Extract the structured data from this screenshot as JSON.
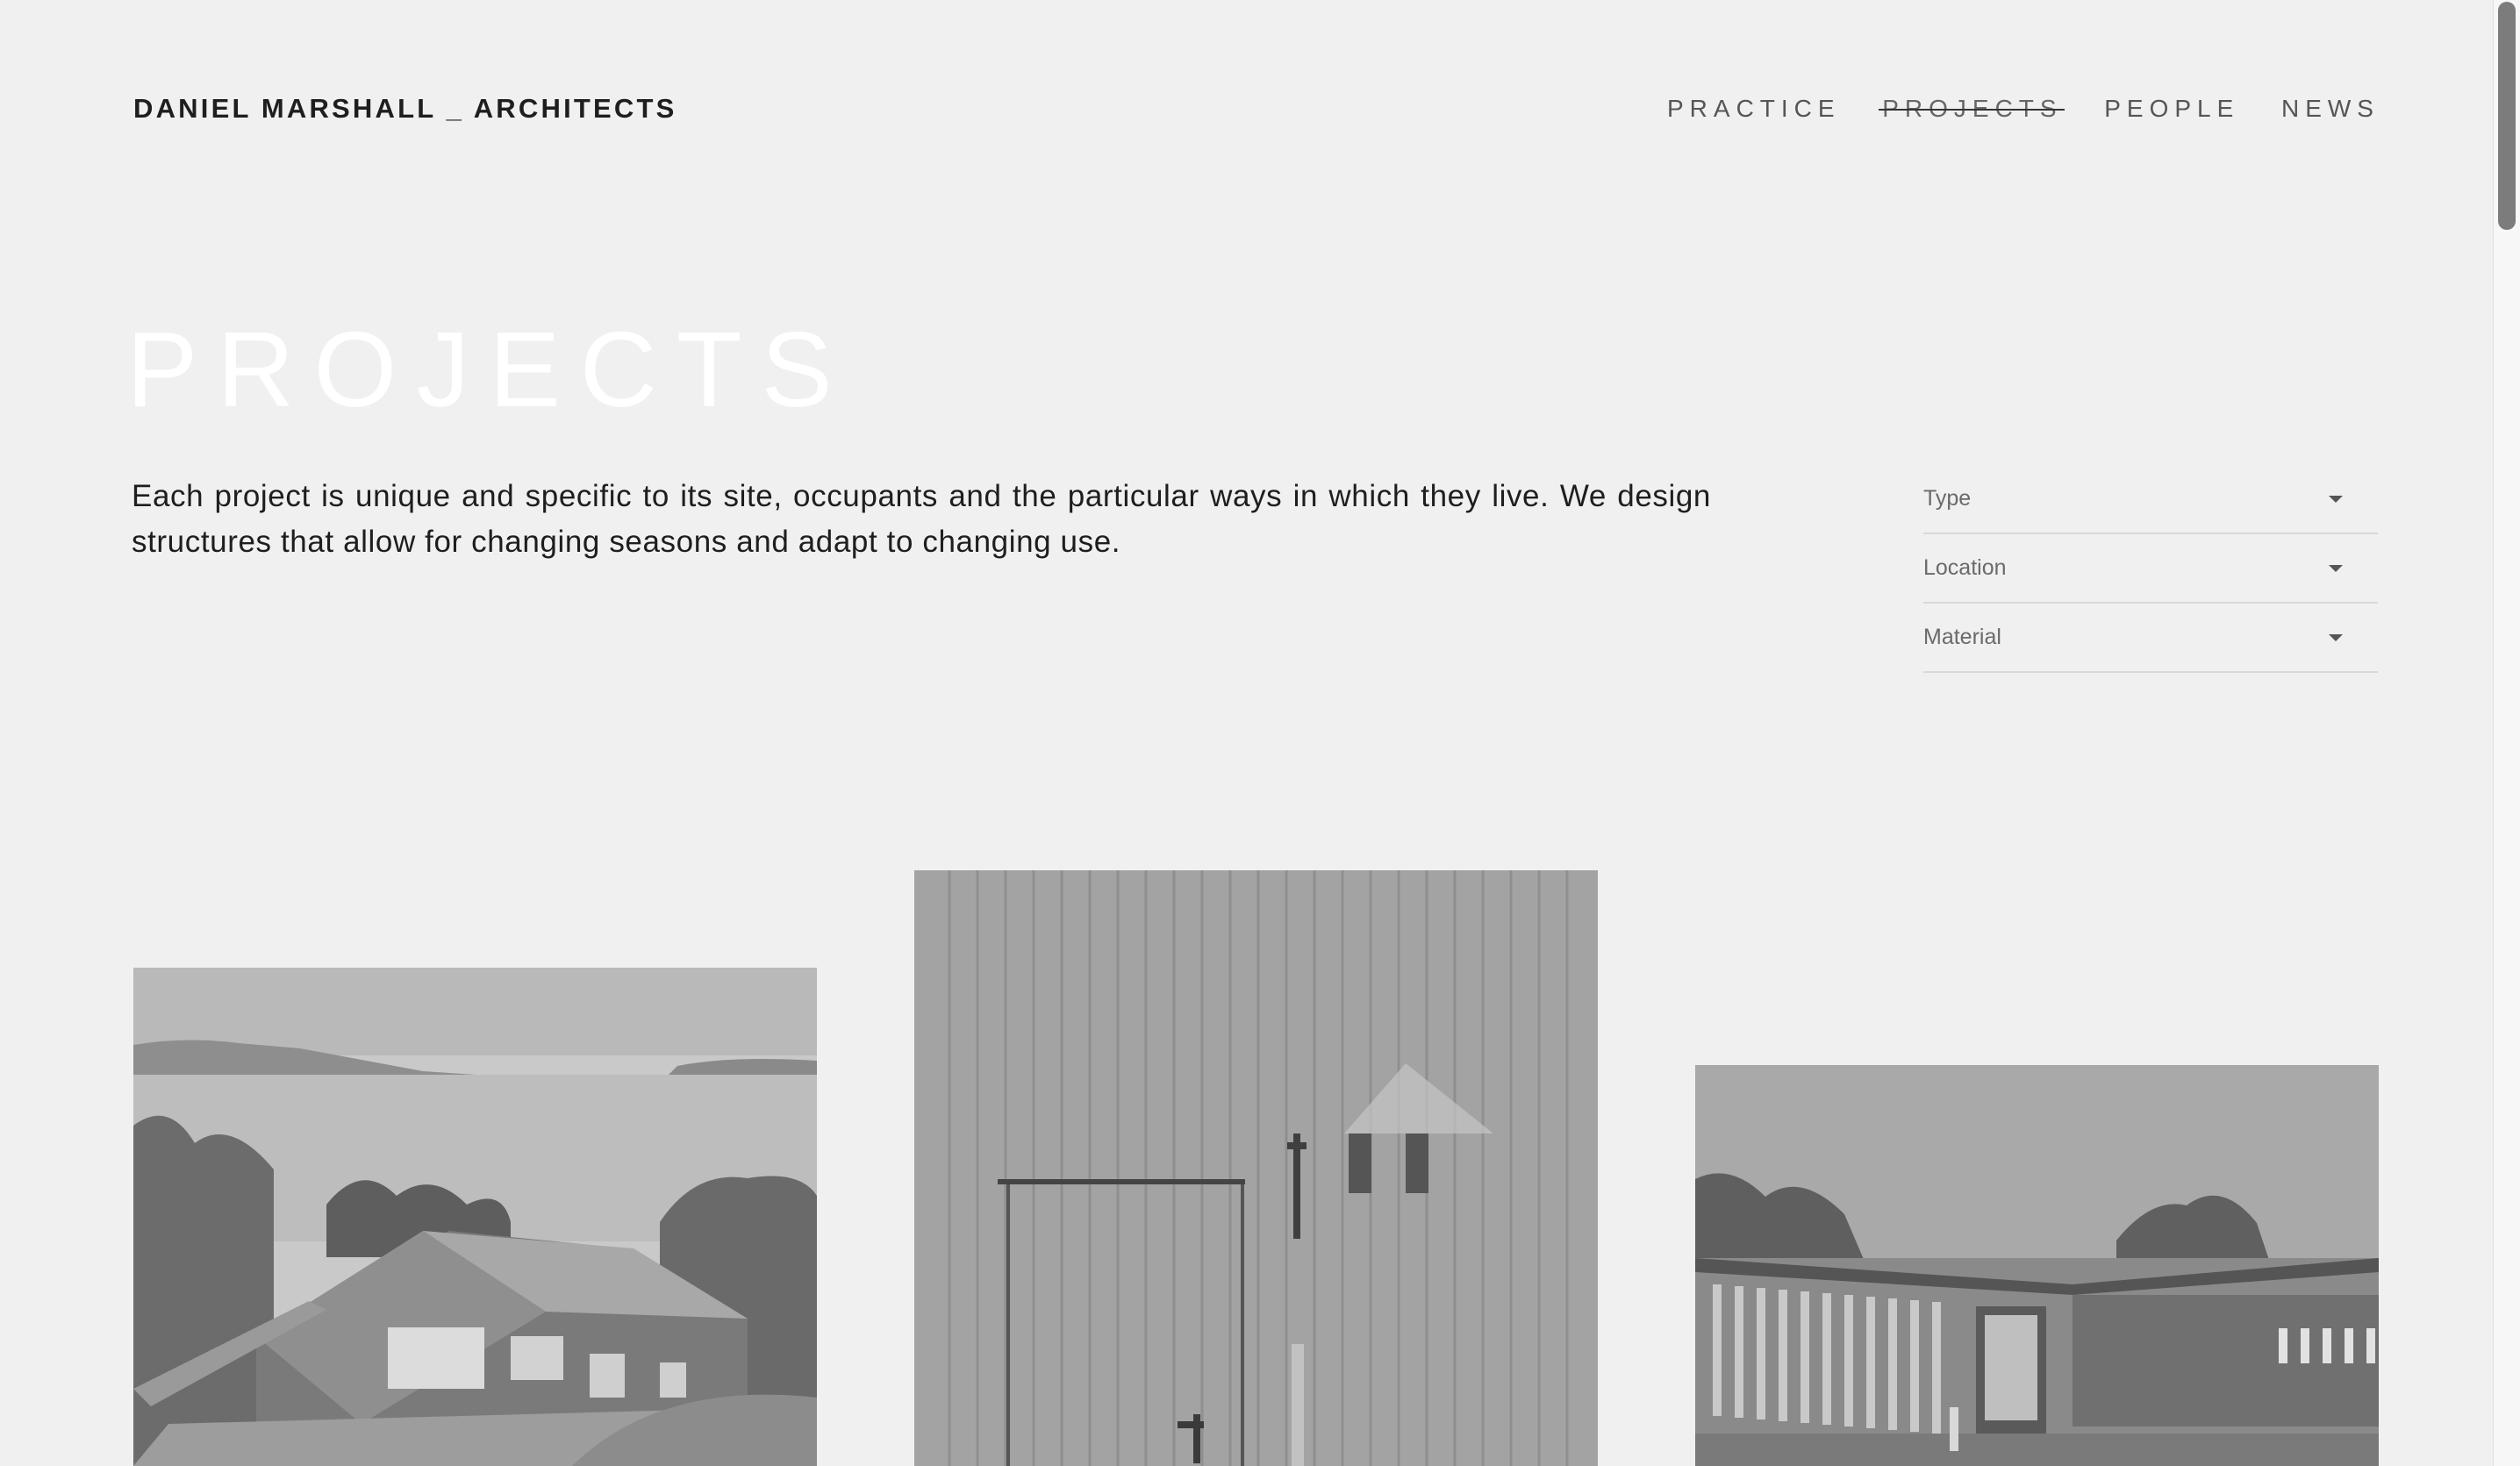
{
  "header": {
    "logo": "DANIEL MARSHALL _ ARCHITECTS",
    "nav": [
      {
        "label": "PRACTICE",
        "active": false
      },
      {
        "label": "PROJECTS",
        "active": true
      },
      {
        "label": "PEOPLE",
        "active": false
      },
      {
        "label": "NEWS",
        "active": false
      }
    ]
  },
  "hero": {
    "title": "PROJECTS",
    "intro": "Each project is unique and specific to its site, occupants and the particular ways in which they live. We design structures that allow for changing seasons and adapt to changing use."
  },
  "filters": [
    {
      "label": "Type",
      "icon": "caret-down-icon"
    },
    {
      "label": "Location",
      "icon": "caret-down-icon"
    },
    {
      "label": "Material",
      "icon": "caret-down-icon"
    }
  ],
  "gallery": [
    {
      "image": "coastal-house-photo"
    },
    {
      "image": "timber-door-photo"
    },
    {
      "image": "courtyard-house-photo"
    }
  ],
  "colors": {
    "background": "#f0f0f0",
    "title": "#ffffff",
    "text": "#1e1e1e",
    "nav": "#555555"
  }
}
